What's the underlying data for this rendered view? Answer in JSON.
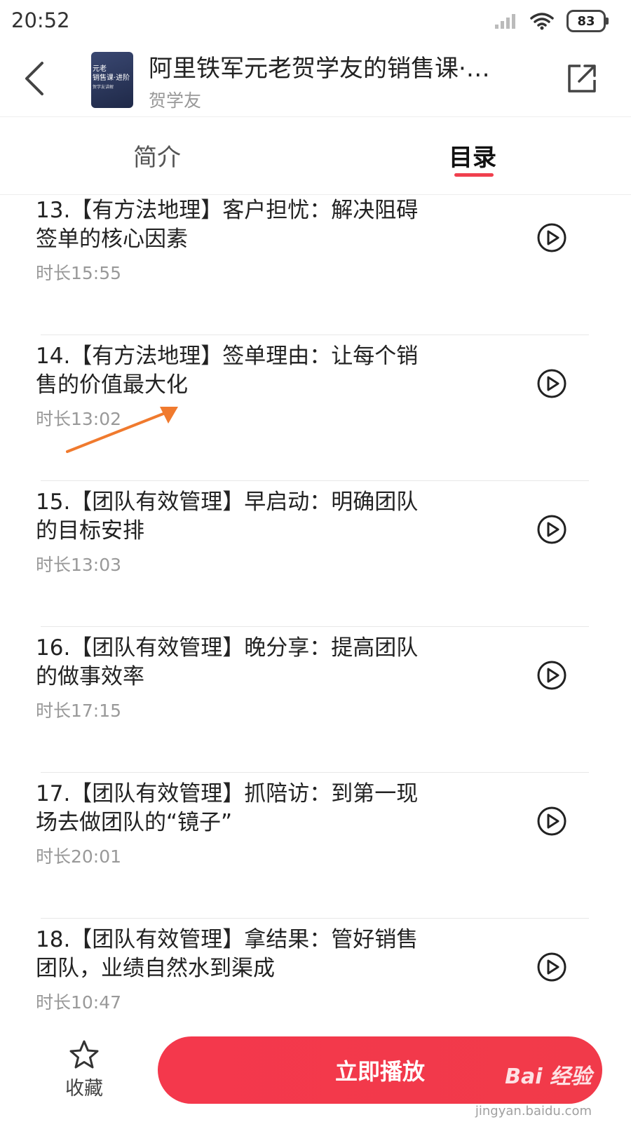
{
  "status_bar": {
    "time": "20:52",
    "battery": "83"
  },
  "header": {
    "cover_lines": [
      "元老",
      "销售课·进阶",
      "贺学友讲解"
    ],
    "title": "阿里铁军元老贺学友的销售课·…",
    "author": "贺学友"
  },
  "tabs": [
    {
      "label": "简介",
      "active": false
    },
    {
      "label": "目录",
      "active": true
    }
  ],
  "lessons": [
    {
      "title": "13.【有方法地理】客户担忧：解决阻碍签单的核心因素",
      "duration": "时长15:55"
    },
    {
      "title": "14.【有方法地理】签单理由：让每个销售的价值最大化",
      "duration": "时长13:02"
    },
    {
      "title": "15.【团队有效管理】早启动：明确团队的目标安排",
      "duration": "时长13:03"
    },
    {
      "title": "16.【团队有效管理】晚分享：提高团队的做事效率",
      "duration": "时长17:15"
    },
    {
      "title": "17.【团队有效管理】抓陪访：到第一现场去做团队的“镜子”",
      "duration": "时长20:01"
    },
    {
      "title": "18.【团队有效管理】拿结果：管好销售团队，业绩自然水到渠成",
      "duration": "时长10:47"
    }
  ],
  "bottom_bar": {
    "favorite_label": "收藏",
    "play_now_label": "立即播放"
  },
  "watermark": {
    "logo": "Bai 经验",
    "url": "jingyan.baidu.com"
  },
  "colors": {
    "accent": "#f13a4a",
    "annotation": "#f07a2e"
  }
}
